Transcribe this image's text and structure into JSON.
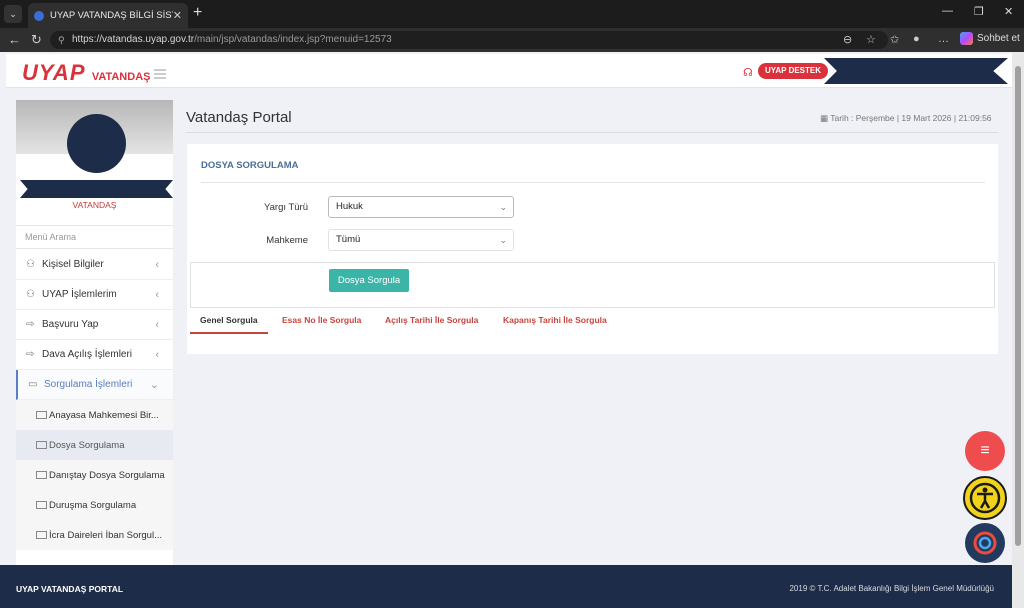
{
  "browser": {
    "tab_title": "UYAP VATANDAŞ BİLGİ SİSTEMİ",
    "url_host": "https://vatandas.uyap.gov.tr",
    "url_path": "/main/jsp/vatandas/index.jsp?menuid=12573",
    "sohbet_label": "Sohbet et"
  },
  "header": {
    "logo_main": "UYAP",
    "logo_sub": "VATANDAŞ",
    "destek_label": "UYAP DESTEK"
  },
  "sidebar": {
    "role": "VATANDAŞ",
    "search_placeholder": "Menü Arama",
    "items": [
      {
        "label": "Kişisel Bilgiler"
      },
      {
        "label": "UYAP İşlemlerim"
      },
      {
        "label": "Başvuru Yap"
      },
      {
        "label": "Dava Açılış İşlemleri"
      },
      {
        "label": "Sorgulama İşlemleri"
      }
    ],
    "subitems": [
      {
        "label": "Anayasa Mahkemesi Bir..."
      },
      {
        "label": "Dosya Sorgulama"
      },
      {
        "label": "Danıştay Dosya Sorgulama"
      },
      {
        "label": "Duruşma Sorgulama"
      },
      {
        "label": "İcra Daireleri İban Sorgul..."
      }
    ]
  },
  "main": {
    "title": "Vatandaş Portal",
    "date": "Tarih : Perşembe | 19 Mart 2026 | 21:09:56",
    "card_title": "DOSYA SORGULAMA",
    "yargi_label": "Yargı Türü",
    "yargi_value": "Hukuk",
    "mahkeme_label": "Mahkeme",
    "mahkeme_value": "Tümü",
    "query_button": "Dosya Sorgula",
    "tabs": [
      {
        "label": "Genel Sorgula"
      },
      {
        "label": "Esas No İle Sorgula"
      },
      {
        "label": "Açılış Tarihi İle Sorgula"
      },
      {
        "label": "Kapanış Tarihi İle Sorgula"
      }
    ]
  },
  "footer": {
    "left": "UYAP VATANDAŞ PORTAL",
    "right": "2019 © T.C. Adalet Bakanlığı Bilgi İşlem Genel Müdürlüğü"
  },
  "colors": {
    "accent_red": "#d9323c",
    "navy": "#1d2c48",
    "teal": "#3bb5a7"
  }
}
